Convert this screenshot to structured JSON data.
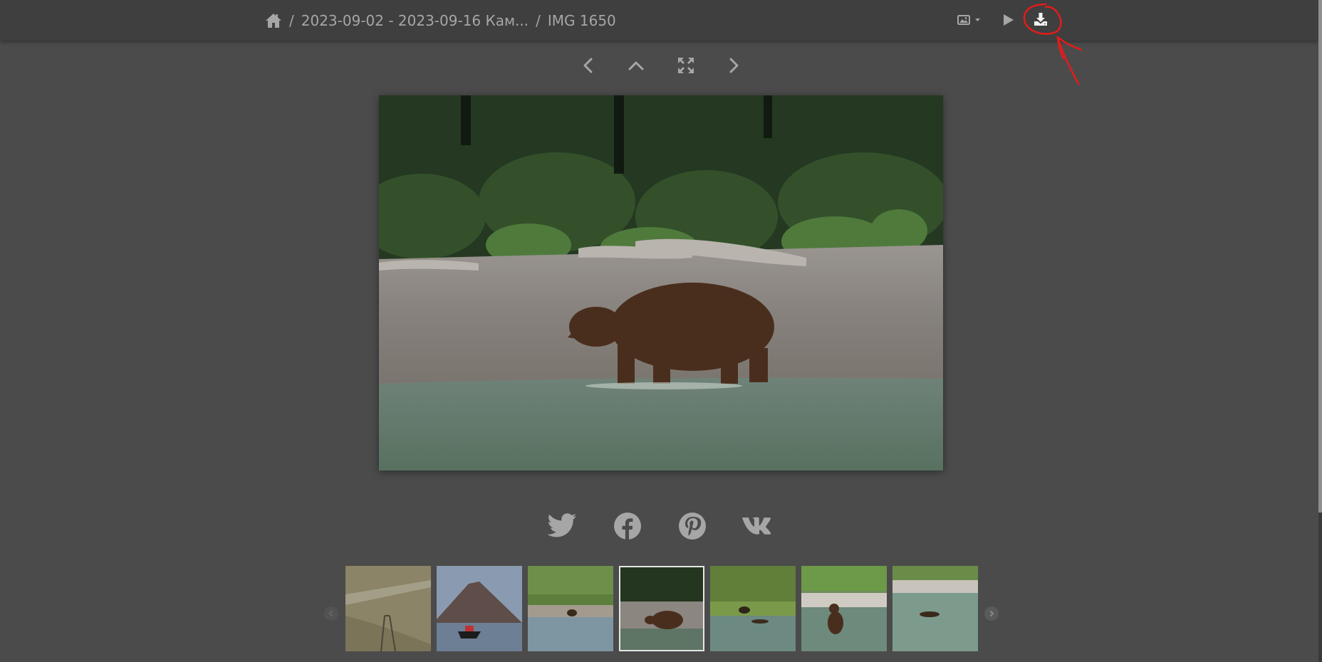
{
  "breadcrumb": {
    "items": [
      {
        "label": "2023-09-02 - 2023-09-16 Кам..."
      },
      {
        "label": "IMG 1650"
      }
    ],
    "separator": "/"
  },
  "toolbar": {
    "icons": [
      "photo-size-icon",
      "caret-down-icon",
      "play-icon",
      "download-icon"
    ]
  },
  "nav": {
    "icons": [
      "chevron-left-icon",
      "chevron-up-icon",
      "fullscreen-icon",
      "chevron-right-icon"
    ]
  },
  "share": {
    "icons": [
      "twitter-icon",
      "facebook-icon",
      "pinterest-icon",
      "vk-icon"
    ]
  },
  "filmstrip": {
    "thumbnails": [
      {
        "scene": "aerial-field"
      },
      {
        "scene": "volcano-boat"
      },
      {
        "scene": "bears-shore"
      },
      {
        "scene": "bear-water",
        "active": true
      },
      {
        "scene": "bears-meadow"
      },
      {
        "scene": "bear-swimming"
      },
      {
        "scene": "bear-lake"
      }
    ]
  },
  "colors": {
    "background": "#4b4b4b",
    "topbar": "#3f3f3f",
    "icon": "#a6a6a6",
    "annotation": "#e31b1b"
  }
}
